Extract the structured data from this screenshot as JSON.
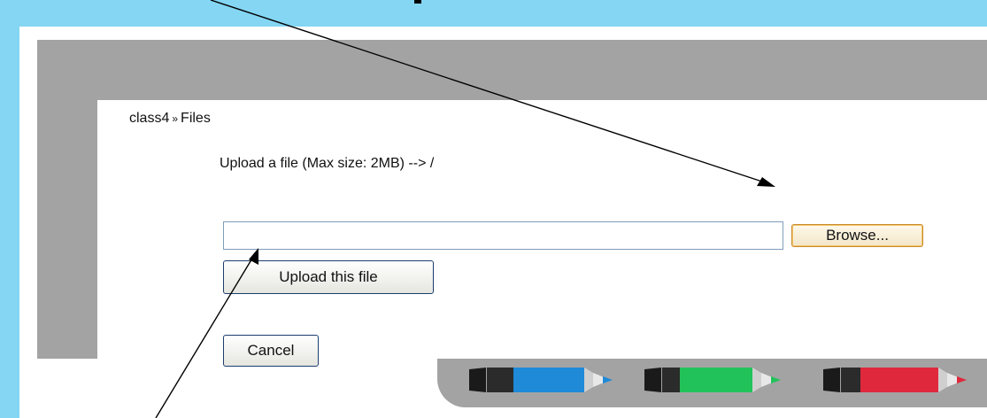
{
  "breadcrumb": {
    "course": "class4",
    "separator": "»",
    "section": "Files"
  },
  "upload": {
    "label": "Upload a file (Max size: 2MB) --> /",
    "file_value": "",
    "browse_label": "Browse...",
    "submit_label": "Upload this file",
    "cancel_label": "Cancel"
  },
  "markers": [
    {
      "name": "blue-marker-icon",
      "color": "#1e8ad8"
    },
    {
      "name": "green-marker-icon",
      "color": "#22c25a"
    },
    {
      "name": "red-marker-icon",
      "color": "#e0283c"
    }
  ],
  "colors": {
    "background_band": "#84d6f3",
    "frame_gray": "#a3a3a3",
    "browse_border": "#c98c2c",
    "button_border": "#1c3d6e"
  }
}
